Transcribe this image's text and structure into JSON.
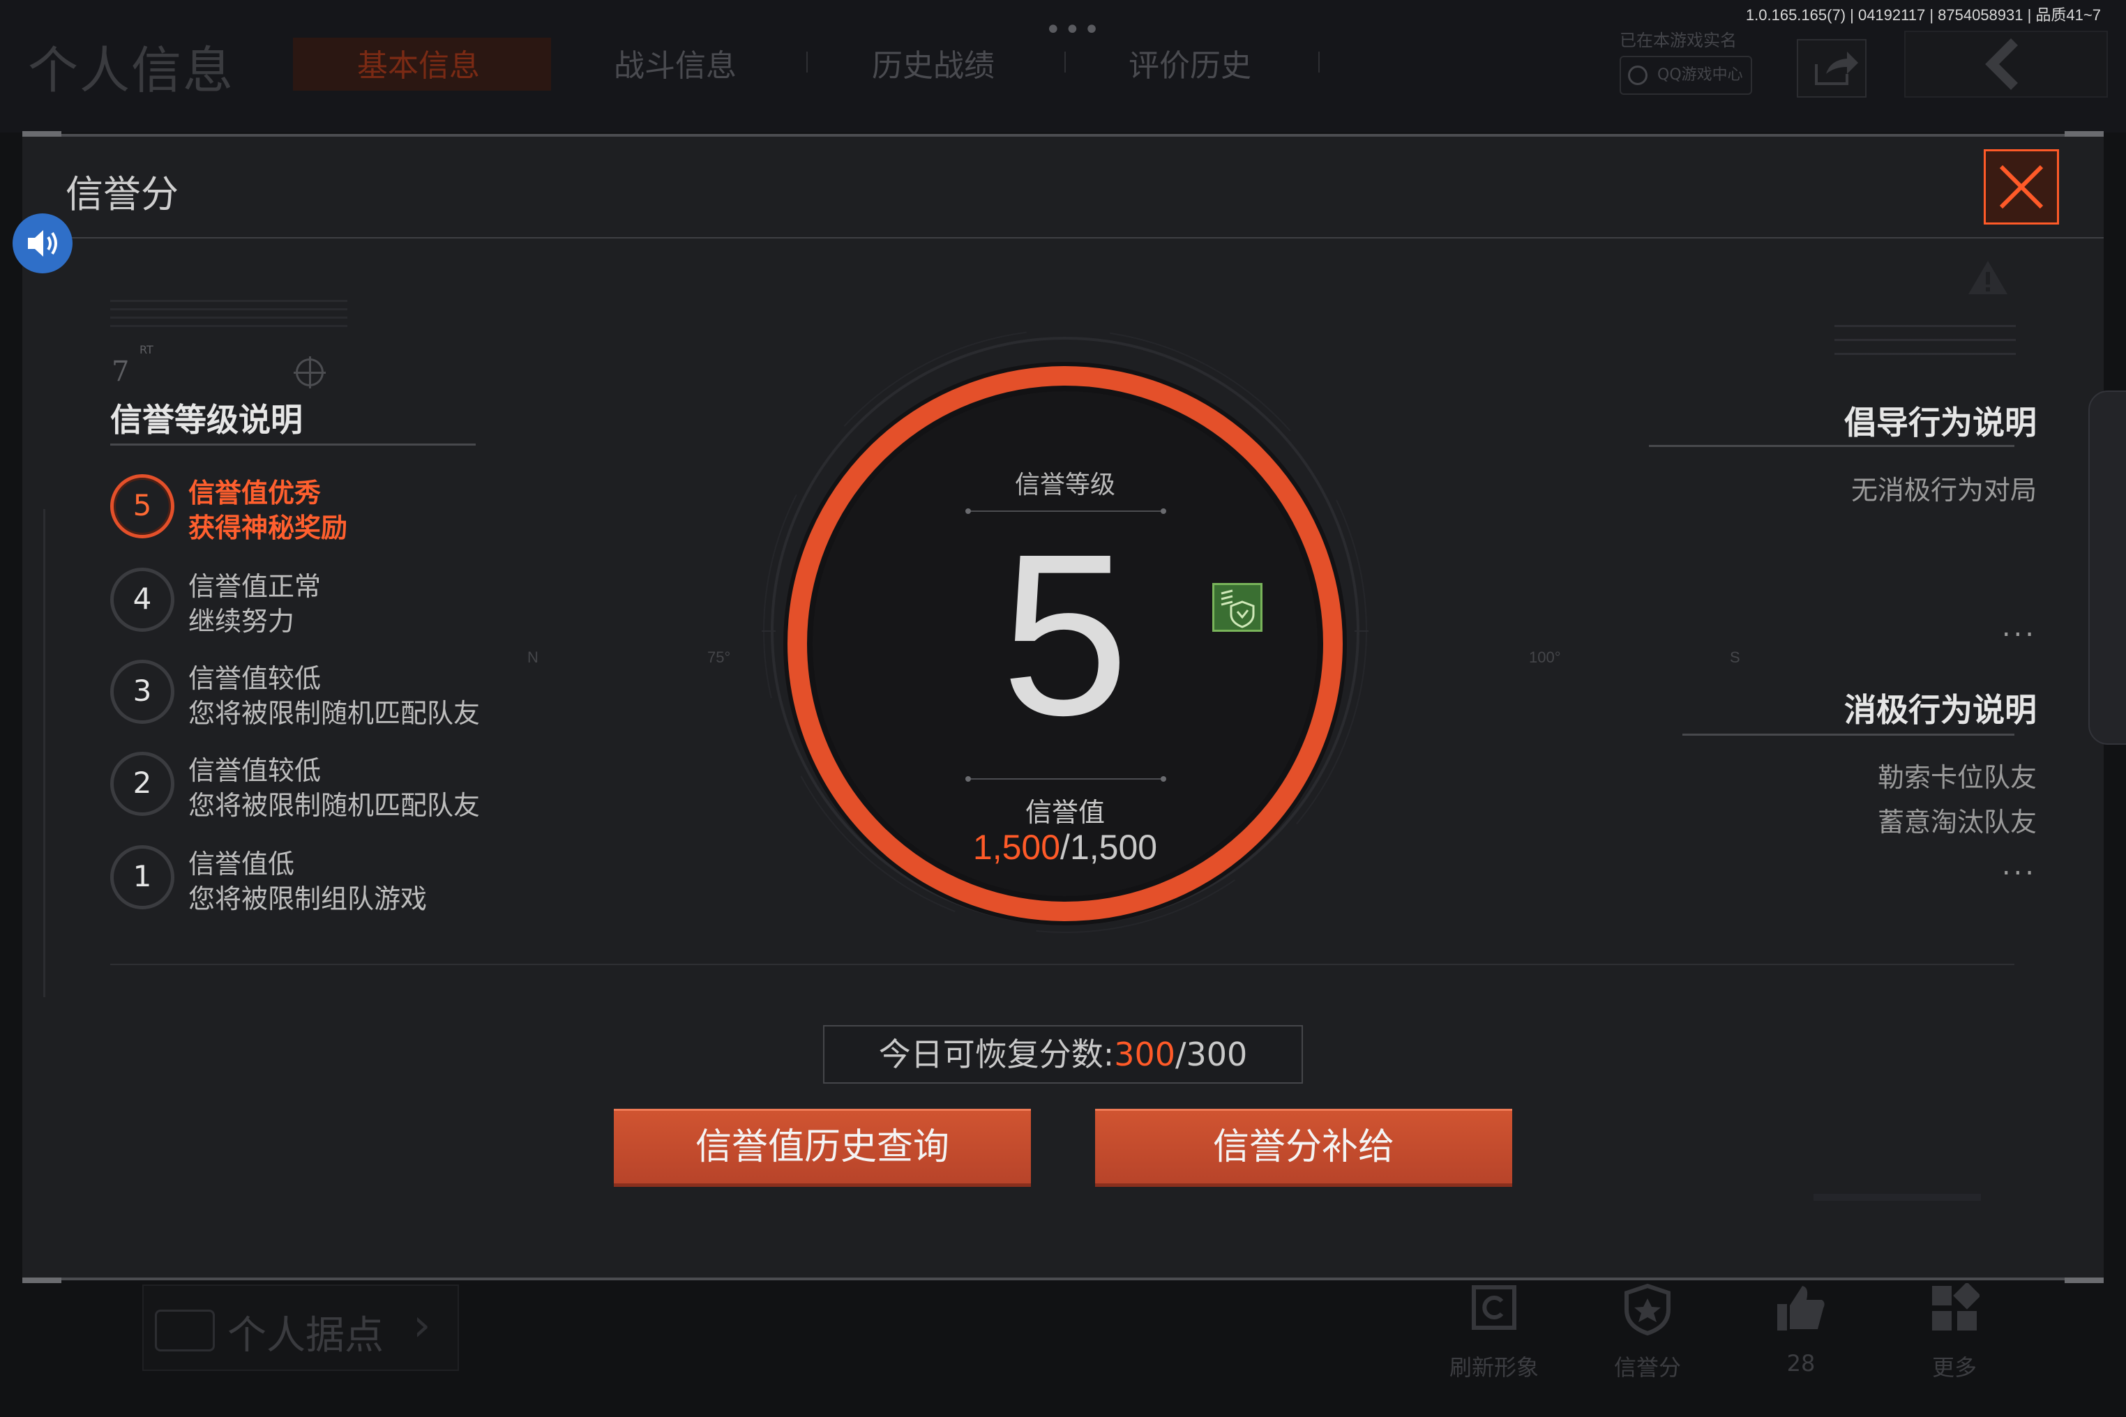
{
  "app": {
    "version": "1.0.165.165(7) | 04192117 | 8754058931 | 品质41~7"
  },
  "background": {
    "title": "个人信息",
    "tabs": [
      {
        "label": "基本信息",
        "active": true
      },
      {
        "label": "战斗信息",
        "active": false
      },
      {
        "label": "历史战绩",
        "active": false
      },
      {
        "label": "评价历史",
        "active": false
      }
    ],
    "more_dots": "•••",
    "realname_text": "已在本游戏实名",
    "qq_center_label": "QQ游戏中心",
    "personal_base_label": "个人据点",
    "bottom_nav": [
      {
        "label": "刷新形象",
        "icon": "refresh-icon"
      },
      {
        "label": "信誉分",
        "icon": "shield-icon"
      },
      {
        "label": "28",
        "icon": "thumbs-up-icon"
      },
      {
        "label": "更多",
        "icon": "grid-icon"
      }
    ]
  },
  "modal": {
    "title": "信誉分",
    "hud_number": "7",
    "hud_rt": "RT",
    "left": {
      "heading": "信誉等级说明",
      "levels": [
        {
          "level": "5",
          "line1": "信誉值优秀",
          "line2": "获得神秘奖励",
          "active": true
        },
        {
          "level": "4",
          "line1": "信誉值正常",
          "line2": "继续努力",
          "active": false
        },
        {
          "level": "3",
          "line1": "信誉值较低",
          "line2": "您将被限制随机匹配队友",
          "active": false
        },
        {
          "level": "2",
          "line1": "信誉值较低",
          "line2": "您将被限制随机匹配队友",
          "active": false
        },
        {
          "level": "1",
          "line1": "信誉值低",
          "line2": "您将被限制组队游戏",
          "active": false
        }
      ]
    },
    "center": {
      "grade_label": "信誉等级",
      "grade_value": "5",
      "credit_label": "信誉值",
      "credit_current": "1,500",
      "credit_sep": "/",
      "credit_max": "1,500",
      "axis_labels": [
        "N",
        "75°",
        "100°",
        "S"
      ]
    },
    "right": {
      "positive_heading": "倡导行为说明",
      "positive_items": [
        "无消极行为对局"
      ],
      "negative_heading": "消极行为说明",
      "negative_items": [
        "勒索卡位队友",
        "蓄意淘汰队友"
      ],
      "ellipsis": "..."
    },
    "recover": {
      "prefix": "今日可恢复分数:",
      "current": "300",
      "sep": "/",
      "max": "300"
    },
    "buttons": {
      "history": "信誉值历史查询",
      "supply": "信誉分补给"
    }
  },
  "colors": {
    "accent": "#ff5a28",
    "ring": "#e4502a",
    "badge": "#3a6f32",
    "speaker": "#2f6fc8"
  }
}
